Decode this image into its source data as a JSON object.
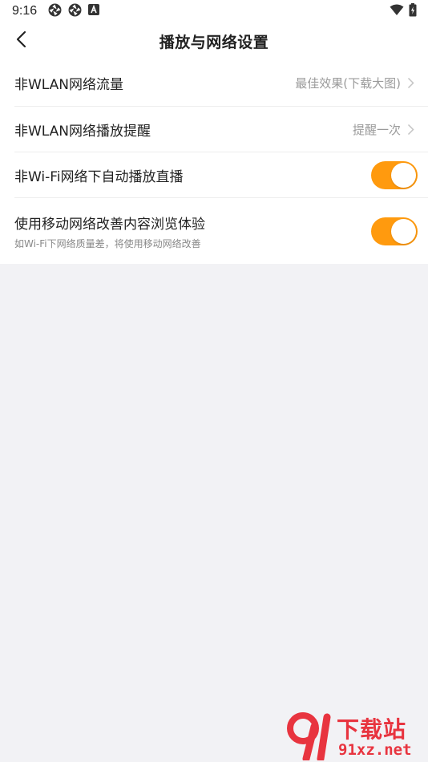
{
  "status_bar": {
    "time": "9:16",
    "icons": [
      "aperture-icon",
      "aperture-icon",
      "font-a-icon"
    ],
    "right_icons": [
      "wifi-icon",
      "battery-charging-icon"
    ]
  },
  "nav": {
    "back_icon": "chevron-left-icon",
    "title": "播放与网络设置"
  },
  "settings": [
    {
      "title": "非WLAN网络流量",
      "value": "最佳效果(下载大图)",
      "control": "chevron"
    },
    {
      "title": "非WLAN网络播放提醒",
      "value": "提醒一次",
      "control": "chevron"
    },
    {
      "title": "非Wi-Fi网络下自动播放直播",
      "control": "toggle",
      "on": true
    },
    {
      "title": "使用移动网络改善内容浏览体验",
      "subtitle": "如Wi-Fi下网络质量差，将使用移动网络改善",
      "control": "toggle",
      "on": true
    }
  ],
  "watermark": {
    "logo_text": "9l",
    "text": "下载站",
    "url": "91xz.net"
  },
  "colors": {
    "accent": "#ff9a0e",
    "background": "#f2f2f5",
    "watermark": "#e8343f"
  }
}
